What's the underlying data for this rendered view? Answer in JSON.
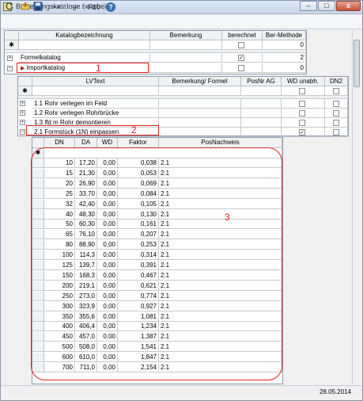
{
  "window": {
    "title": "Bewertungskataloge bearbeiten"
  },
  "window_buttons": {
    "minimize": "–",
    "maximize": "□",
    "close": "x"
  },
  "toolbar": {
    "add_label": "++",
    "remove_label": "--",
    "f10_label": "F10",
    "help_label": "?"
  },
  "main_grid": {
    "headers": [
      "Katalogbezeichnung",
      "Bemerkung",
      "berechnet",
      "Ber-Methode"
    ],
    "new_row_marker": "✱",
    "new_row": {
      "method": "0"
    },
    "rows": [
      {
        "expander": "+",
        "name": "Formelkatalog",
        "remark": "",
        "calculated": true,
        "method": "2"
      },
      {
        "expander": "−",
        "name": "Importkatalog",
        "remark": "",
        "calculated": false,
        "method": "0"
      }
    ]
  },
  "sub_grid": {
    "headers": [
      "LVText",
      "Bemerkung/ Formel",
      "PosNr AG",
      "WD unabh.",
      "DN2"
    ],
    "new_row_marker": "✱",
    "rows": [
      {
        "expander": "+",
        "text": "1.1 Rohr verlegen im Feld",
        "wd": false,
        "dn2": false
      },
      {
        "expander": "+",
        "text": "1.2 Rohr verlegen Rohrbrücke",
        "wd": false,
        "dn2": false
      },
      {
        "expander": "+",
        "text": "1.3 lfd m Rohr demontieren",
        "wd": false,
        "dn2": false
      },
      {
        "expander": "−",
        "text": "2.1 Formstück (1N) einpassen",
        "wd": true,
        "dn2": false
      }
    ]
  },
  "detail_grid": {
    "headers": [
      "DN",
      "DA",
      "WD",
      "Faktor",
      "PosNachweis"
    ],
    "new_row_marker": "✱",
    "rows": [
      [
        "10",
        "17,20",
        "0,00",
        "0,038",
        "2.1"
      ],
      [
        "15",
        "21,30",
        "0,00",
        "0,053",
        "2.1"
      ],
      [
        "20",
        "26,90",
        "0,00",
        "0,069",
        "2.1"
      ],
      [
        "25",
        "33,70",
        "0,00",
        "0,084",
        "2.1"
      ],
      [
        "32",
        "42,40",
        "0,00",
        "0,105",
        "2.1"
      ],
      [
        "40",
        "48,30",
        "0,00",
        "0,130",
        "2.1"
      ],
      [
        "50",
        "60,30",
        "0,00",
        "0,161",
        "2.1"
      ],
      [
        "65",
        "76,10",
        "0,00",
        "0,207",
        "2.1"
      ],
      [
        "80",
        "88,90",
        "0,00",
        "0,253",
        "2.1"
      ],
      [
        "100",
        "114,3",
        "0,00",
        "0,314",
        "2.1"
      ],
      [
        "125",
        "139,7",
        "0,00",
        "0,391",
        "2.1"
      ],
      [
        "150",
        "168,3",
        "0,00",
        "0,467",
        "2.1"
      ],
      [
        "200",
        "219,1",
        "0,00",
        "0,621",
        "2.1"
      ],
      [
        "250",
        "273,0",
        "0,00",
        "0,774",
        "2.1"
      ],
      [
        "300",
        "323,9",
        "0,00",
        "0,927",
        "2.1"
      ],
      [
        "350",
        "355,6",
        "0,00",
        "1,081",
        "2.1"
      ],
      [
        "400",
        "406,4",
        "0,00",
        "1,234",
        "2.1"
      ],
      [
        "450",
        "457,0",
        "0,00",
        "1,387",
        "2.1"
      ],
      [
        "500",
        "508,0",
        "0,00",
        "1,541",
        "2.1"
      ],
      [
        "600",
        "610,0",
        "0,00",
        "1,847",
        "2.1"
      ],
      [
        "700",
        "711,0",
        "0,00",
        "2,154",
        "2.1"
      ]
    ]
  },
  "annotations": [
    "1",
    "2",
    "3"
  ],
  "status": {
    "date": "28.05.2014"
  },
  "colors": {
    "annotation": "#dd2222",
    "header_bg": "#f1f2f4",
    "grid_line": "#c5c9cf"
  }
}
